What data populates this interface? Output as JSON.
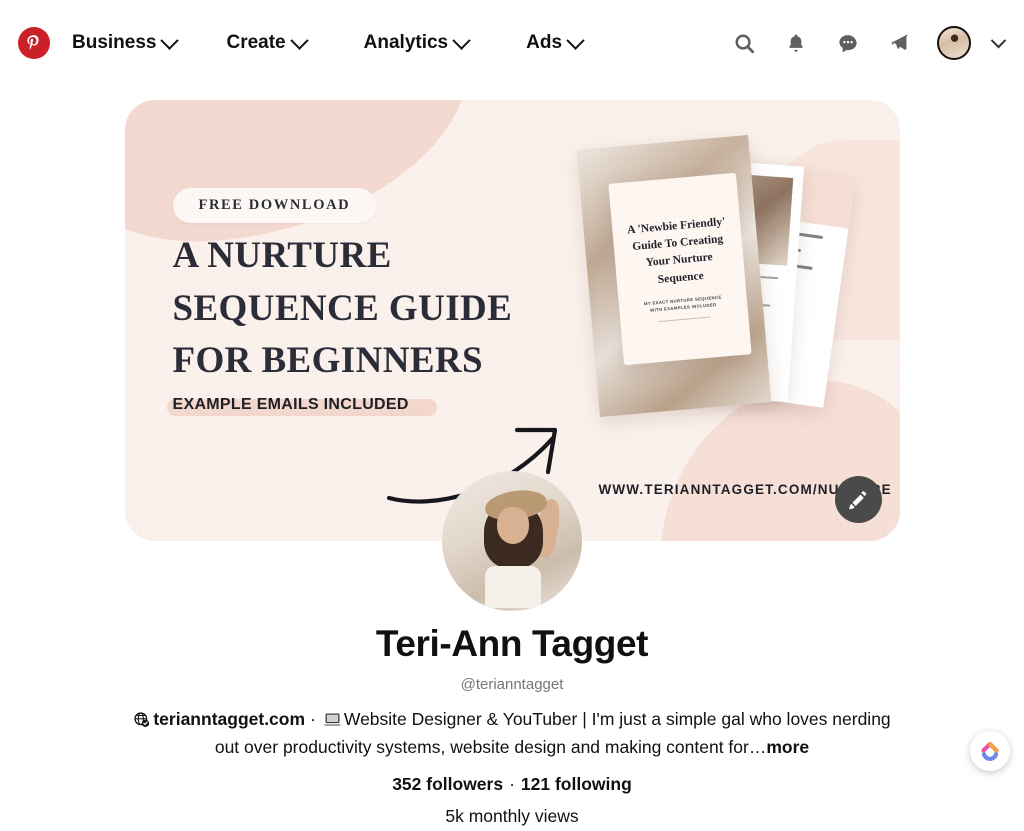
{
  "nav": {
    "logo_icon": "pinterest-logo-icon",
    "items": [
      {
        "label": "Business",
        "chevron": "chevron-down-icon"
      },
      {
        "label": "Create",
        "chevron": "chevron-down-icon"
      },
      {
        "label": "Analytics",
        "chevron": "chevron-down-icon"
      },
      {
        "label": "Ads",
        "chevron": "chevron-down-icon"
      }
    ],
    "actions": [
      {
        "icon": "search-icon"
      },
      {
        "icon": "bell-icon"
      },
      {
        "icon": "messages-icon"
      },
      {
        "icon": "megaphone-icon"
      },
      {
        "icon": "account-avatar"
      },
      {
        "icon": "chevron-down-icon"
      }
    ]
  },
  "banner": {
    "pill_label": "FREE DOWNLOAD",
    "headline_line1": "A NURTURE",
    "headline_line2": "SEQUENCE GUIDE",
    "headline_line3": "FOR BEGINNERS",
    "subline": "EXAMPLE EMAILS INCLUDED",
    "url": "WWW.TERIANNTAGGET.COM/NURTURE",
    "arrow_icon": "curved-arrow-icon",
    "edit_icon": "pencil-icon",
    "mockup": {
      "title": "A 'Newbie Friendly' Guide To Creating Your Nurture Sequence",
      "subtitle_line1": "MY EXACT NURTURE SEQUENCE",
      "subtitle_line2": "WITH EXAMPLES INCLUDED",
      "back_page_text_1": "e For",
      "back_page_text_2": "Look"
    },
    "colors": {
      "background": "#fbf1ec",
      "blob": "#f3d9cf",
      "highlight": "#f3d7cd",
      "text": "#2a2d38",
      "fab": "#4a4a4a"
    }
  },
  "profile": {
    "avatar_name": "profile-avatar",
    "display_name": "Teri-Ann Tagget",
    "handle": "@terianntagget",
    "bio": {
      "verified_icon": "verified-globe-icon",
      "website": "terianntagget.com",
      "separator": "·",
      "laptop_icon": "laptop-icon",
      "text": "Website Designer & YouTuber | I'm just a simple gal who loves nerding out over productivity systems, website design and making content for…",
      "more_label": "more"
    },
    "stats": {
      "followers": "352 followers",
      "separator": "·",
      "following": "121 following",
      "monthly_views": "5k monthly views"
    }
  },
  "floating_widget": {
    "icon": "chevron-arc-widget-icon",
    "colors": {
      "pink": "#e8549a",
      "orange": "#f5a04c",
      "blue": "#6f8ae8"
    }
  }
}
